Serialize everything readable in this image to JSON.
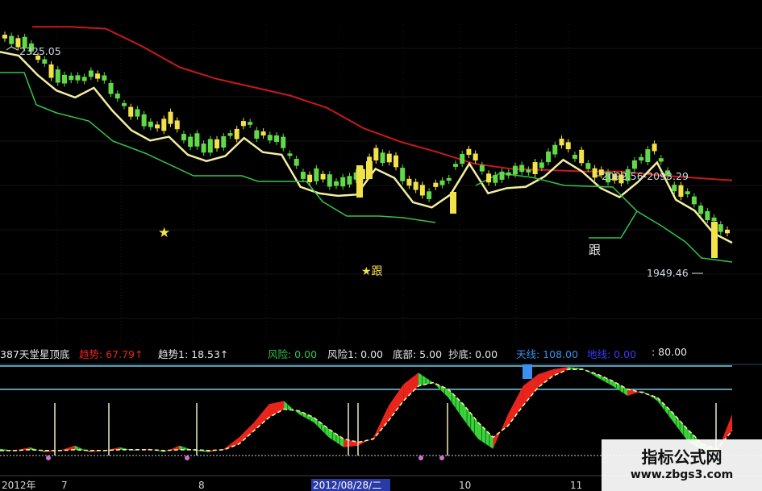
{
  "colors": {
    "background": "#000000",
    "up_candle": "#f2e24a",
    "down_candle": "#62d94a",
    "resistance_line": "#c8191e",
    "support_curve": "#f4eda0",
    "trend_line": "#34c44a",
    "indicator_red": "#e8241c",
    "indicator_green": "#38d43a",
    "hline": "#7ec9e6",
    "date_highlight": "#2a3aa8"
  },
  "chart_data": [
    {
      "type": "candlestick",
      "name": "price panel",
      "annotations": {
        "high_label": "2325.05",
        "range_label": "2092.56-2093.29",
        "low_label": "1949.46",
        "star_marker": "★",
        "star_follow_marker": "★跟",
        "follow_marker": "跟"
      },
      "y_range": [
        1940,
        2335
      ],
      "resistance_line": [
        2331,
        2331,
        2328,
        2300,
        2268,
        2250,
        2237,
        2224,
        2205,
        2173,
        2152,
        2136,
        2118,
        2110,
        2108,
        2106,
        2106,
        2100,
        2096,
        2092
      ],
      "support_curve": [
        2292,
        2286,
        2256,
        2232,
        2221,
        2236,
        2200,
        2170,
        2154,
        2160,
        2132,
        2122,
        2130,
        2158,
        2136,
        2132,
        2082,
        2072,
        2068,
        2070,
        2110,
        2096,
        2058,
        2050,
        2070,
        2118,
        2072,
        2080,
        2082,
        2098,
        2124,
        2106,
        2080,
        2066,
        2090,
        2120,
        2062,
        2045,
        2010,
        1995
      ],
      "candles_note": "approximate closing path from 2325 high to 1949 low, then rebound"
    },
    {
      "type": "area",
      "name": "indicator panel",
      "series_labels": [
        {
          "text": "387天堂星顶底",
          "color": "#e6e6e6"
        },
        {
          "text": "趋势: 67.79↑",
          "color": "#e8241c"
        },
        {
          "text": "趋势1: 18.53↑",
          "color": "#e6e6e6"
        },
        {
          "text": "风险: 0.00",
          "color": "#34c44a"
        },
        {
          "text": "风险1: 0.00",
          "color": "#e6e6e6"
        },
        {
          "text": "底部: 5.00",
          "color": "#e6e6e6"
        },
        {
          "text": "抄底: 0.00",
          "color": "#e6e6e6"
        },
        {
          "text": "天线: 108.00",
          "color": "#3a8ff0"
        },
        {
          "text": "地线: 0.00",
          "color": "#3a3aff"
        },
        {
          "text": ": 80.00",
          "color": "#e6e6e6"
        }
      ],
      "ylim": [
        0,
        110
      ],
      "hlines": [
        108,
        80
      ],
      "trend_values": [
        8,
        6,
        10,
        4,
        6,
        12,
        4,
        6,
        10,
        6,
        8,
        4,
        12,
        6,
        4,
        8,
        22,
        40,
        62,
        66,
        50,
        40,
        22,
        10,
        12,
        22,
        60,
        86,
        100,
        88,
        70,
        44,
        20,
        8,
        50,
        84,
        98,
        104,
        107,
        105,
        94,
        84,
        72,
        78,
        66,
        42,
        18,
        6,
        4,
        50
      ],
      "trend1_values": [
        6,
        6,
        7,
        6,
        6,
        7,
        6,
        6,
        7,
        7,
        7,
        6,
        7,
        7,
        6,
        7,
        14,
        30,
        46,
        56,
        54,
        46,
        32,
        20,
        16,
        20,
        42,
        66,
        84,
        88,
        80,
        62,
        40,
        22,
        36,
        60,
        82,
        96,
        104,
        104,
        98,
        90,
        80,
        76,
        70,
        52,
        32,
        14,
        8,
        30
      ]
    }
  ],
  "x_axis": {
    "ticks": [
      {
        "label": "2012年",
        "highlight": false
      },
      {
        "label": "7",
        "highlight": false
      },
      {
        "label": "8",
        "highlight": false
      },
      {
        "label": "2012/08/28/二",
        "highlight": true
      },
      {
        "label": "10",
        "highlight": false
      },
      {
        "label": "11",
        "highlight": false
      }
    ]
  },
  "watermark": {
    "name": "指标公式网",
    "url": "www.zbgs3.com"
  }
}
